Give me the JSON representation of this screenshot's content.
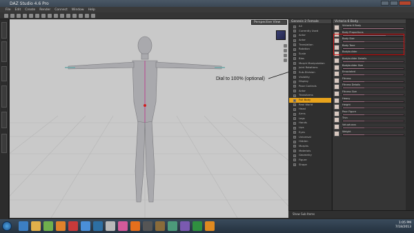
{
  "window": {
    "title": "DAZ Studio 4.6 Pro"
  },
  "menu": [
    "File",
    "Edit",
    "Create",
    "Render",
    "Connect",
    "Window",
    "Help"
  ],
  "viewport": {
    "camera_dropdown": "Perspective View",
    "annotation": "Dial to 100% (optional)"
  },
  "scene": {
    "header": "Genesis 2 Female",
    "rows": [
      "All",
      "Currently Used",
      "Actor",
      "Actor",
      "Translation",
      "Rotation",
      "Scale",
      "Bias",
      "Morph Manipulation",
      "Joint Rotations",
      "Sub-Division",
      "Visibility",
      "Display",
      "Pose Controls",
      "Actor",
      "Transforms",
      "Full Body",
      "Real World",
      "Head",
      "Arms",
      "Legs",
      "Hands",
      "Lips",
      "Eyes",
      "Universal",
      "Hidden",
      "Morphs",
      "Materials",
      "Geometry",
      "Figure",
      "Shape"
    ],
    "selected_index": 16,
    "footer": "Show Sub Items"
  },
  "properties": {
    "header": "Victoria 6 Body",
    "items": [
      {
        "label": "Victoria 6 Body",
        "value": 1.0
      },
      {
        "label": "Body Proportions",
        "value": 0.7
      },
      {
        "label": "Body Size",
        "value": 0.35
      },
      {
        "label": "Body Tone",
        "value": 0.35
      },
      {
        "label": "Bodybuilder",
        "value": 0.35
      },
      {
        "label": "Bodybuilder Details",
        "value": 0.35
      },
      {
        "label": "Bodybuilder Size",
        "value": 0.35
      },
      {
        "label": "Emaciated",
        "value": 0.35
      },
      {
        "label": "Fitness",
        "value": 0.35
      },
      {
        "label": "Fitness Details",
        "value": 0.35
      },
      {
        "label": "Fitness Size",
        "value": 0.35
      },
      {
        "label": "Heavy",
        "value": 0.35
      },
      {
        "label": "Height",
        "value": 0.35
      },
      {
        "label": "Pear Figure",
        "value": 0.35
      },
      {
        "label": "Thin",
        "value": 0.35
      },
      {
        "label": "Voluptuous",
        "value": 0.35
      },
      {
        "label": "Weight",
        "value": 0.35
      }
    ]
  },
  "taskbar": {
    "time": "1:05 PM",
    "date": "7/18/2013",
    "apps": [
      "explorer",
      "folder",
      "media",
      "blender",
      "daz",
      "chrome",
      "photoshop",
      "notepad",
      "paint",
      "firefox",
      "unity",
      "gimp",
      "network",
      "video",
      "excel",
      "firefox-alt"
    ]
  },
  "colors": {
    "viewport_bg": "#c9c9c9",
    "selection": "#e8a31c",
    "slider": "#6b4e5a",
    "highlight": "#d01010"
  }
}
